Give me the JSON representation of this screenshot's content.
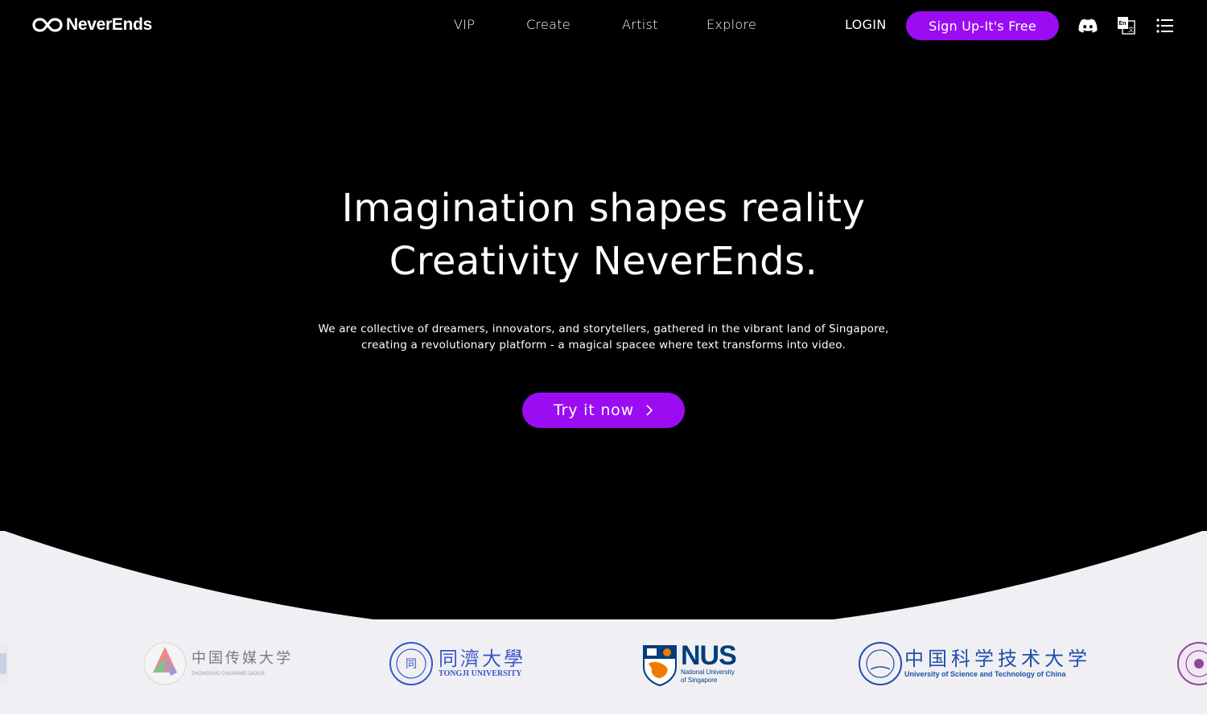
{
  "brand": {
    "name": "NeverEnds",
    "accent_color": "#9b0cf3"
  },
  "nav": {
    "links": [
      {
        "label": "VIP"
      },
      {
        "label": "Create"
      },
      {
        "label": "Artist"
      },
      {
        "label": "Explore"
      }
    ],
    "login_label": "LOGIN",
    "signup_label": "Sign Up-It's Free",
    "icons": [
      "discord-icon",
      "language-icon",
      "menu-list-icon"
    ]
  },
  "hero": {
    "headline_line1": "Imagination shapes reality",
    "headline_line2": "Creativity NeverEnds.",
    "subline_line1": "We are collective of dreamers, innovators, and storytellers, gathered in the vibrant land of Singapore,",
    "subline_line2": "creating a revolutionary platform - a magical spacee where text transforms into video.",
    "cta_label": "Try it now"
  },
  "partners": [
    {
      "name_cn": "中国传媒大学",
      "name_en": "ZHONGGUO CHUANMEI DAXUE",
      "color": "#8a8a8a"
    },
    {
      "name_cn": "同濟大學",
      "name_en": "TONGJI UNIVERSITY",
      "color": "#3a56c8"
    },
    {
      "name_cn": "",
      "name_en": "NUS",
      "subtitle": "National University of Singapore",
      "color": "#003d7c"
    },
    {
      "name_cn": "中国科学技术大学",
      "name_en": "University of Science and Technology of China",
      "color": "#1f4fa8"
    }
  ]
}
